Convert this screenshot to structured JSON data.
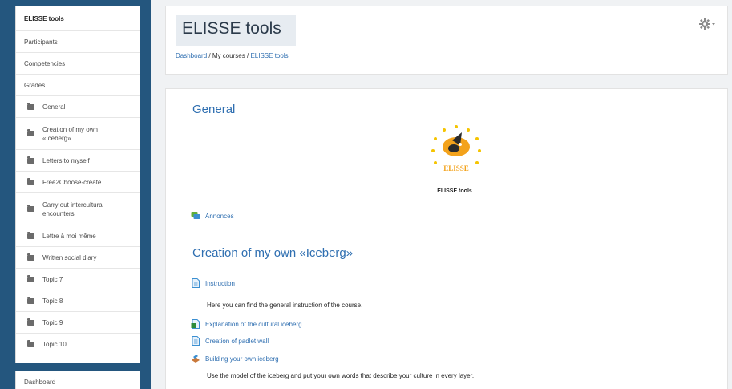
{
  "sidebar": {
    "items": [
      {
        "label": "ELISSE tools"
      },
      {
        "label": "Participants"
      },
      {
        "label": "Competencies"
      },
      {
        "label": "Grades"
      }
    ],
    "sections": [
      {
        "label": "General"
      },
      {
        "label": "Creation of my own «Iceberg»"
      },
      {
        "label": "Letters to myself"
      },
      {
        "label": "Free2Choose-create"
      },
      {
        "label": "Carry out intercultural encounters"
      },
      {
        "label": "Lettre à moi même"
      },
      {
        "label": "Written social diary"
      },
      {
        "label": "Topic 7"
      },
      {
        "label": "Topic 8"
      },
      {
        "label": "Topic 9"
      },
      {
        "label": "Topic 10"
      }
    ],
    "dashboard_label": "Dashboard"
  },
  "header": {
    "title": "ELISSE tools",
    "breadcrumb": {
      "dashboard": "Dashboard",
      "sep1": "/",
      "my_courses": "My courses",
      "sep2": "/",
      "course": "ELISSE tools"
    },
    "settings_icon": "gear-icon"
  },
  "main": {
    "general": {
      "title": "General",
      "logo_text": "ELISSE",
      "logo_caption": "ELISSE tools",
      "announcements": "Annonces"
    },
    "iceberg": {
      "title": "Creation of my own «Iceberg»",
      "instruction": "Instruction",
      "instruction_desc": "Here you can find the general instruction of the course.",
      "explanation": "Explanation of the cultural iceberg",
      "padlet": "Creation of padlet wall",
      "building": "Building your own iceberg",
      "building_desc": "Use the model of the iceberg and put your own words that describe your culture in every layer."
    }
  },
  "colors": {
    "frame_blue": "#24567e",
    "link_blue": "#2f6fb1",
    "logo_orange": "#f3a21b",
    "star_yellow": "#f5c400"
  }
}
